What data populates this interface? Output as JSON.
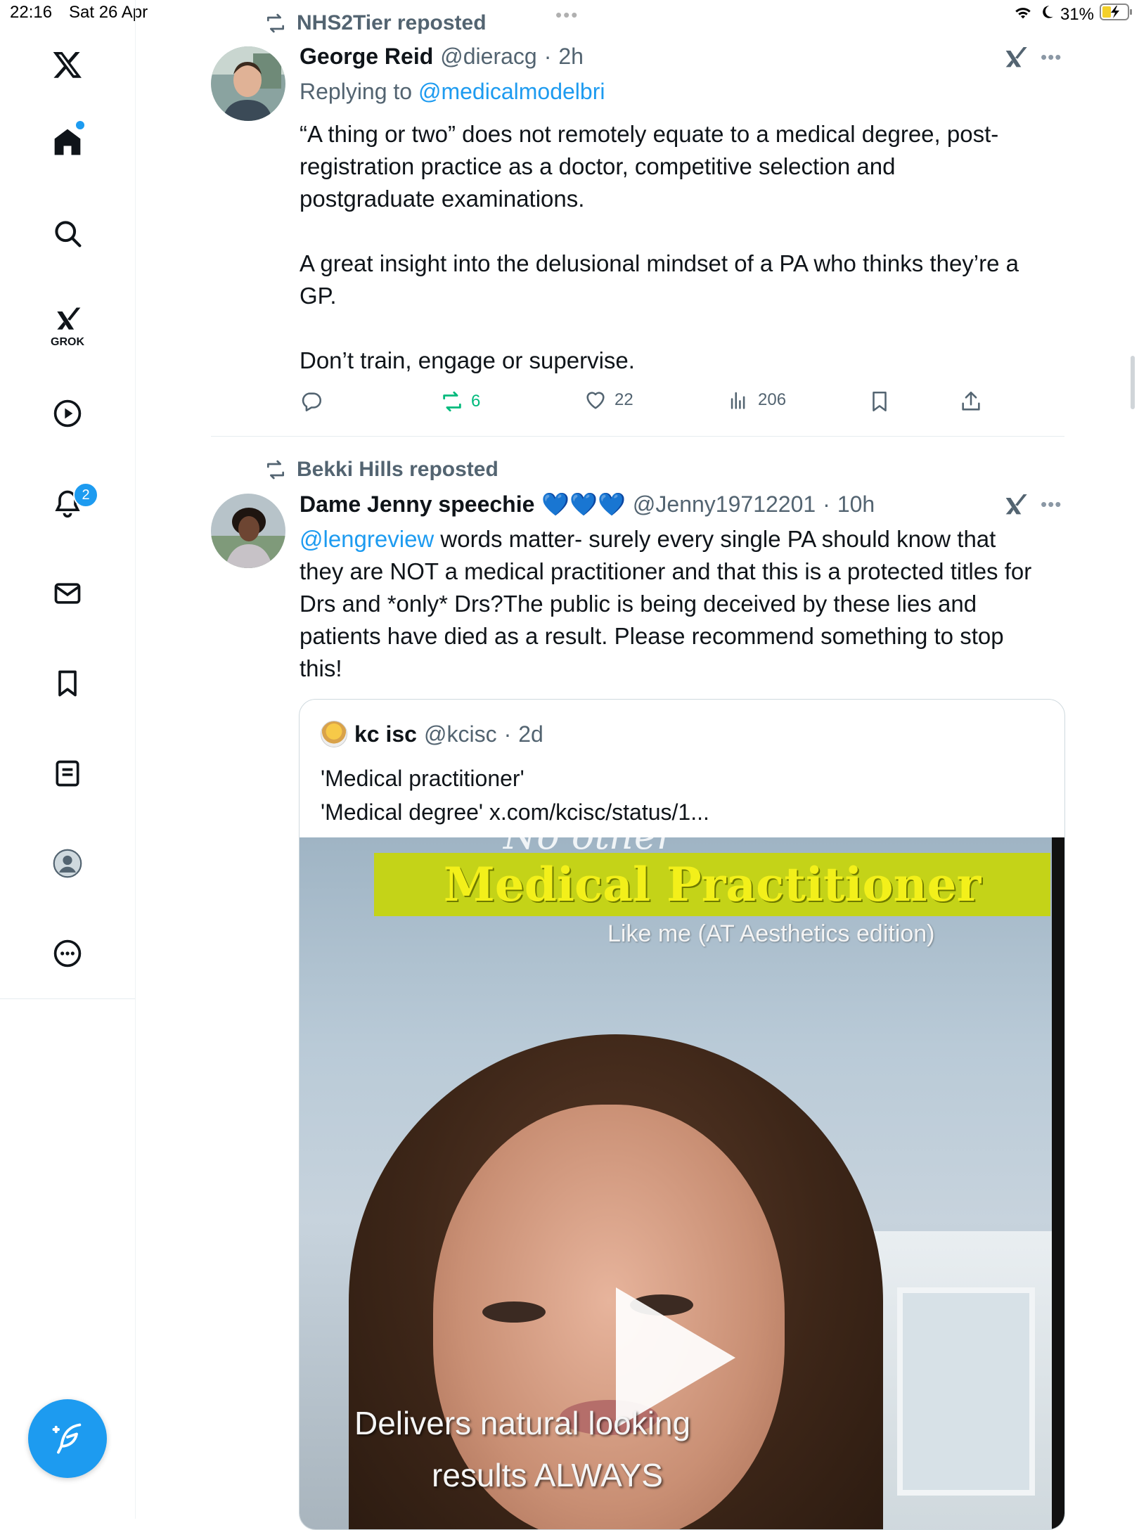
{
  "status_bar": {
    "time": "22:16",
    "date": "Sat 26 Apr",
    "battery": "31%",
    "icons": [
      "wifi-icon",
      "moon-icon",
      "battery-charging-icon"
    ]
  },
  "sidebar": {
    "items": [
      {
        "name": "x-logo-icon"
      },
      {
        "name": "home-icon",
        "has_dot": true
      },
      {
        "name": "search-icon"
      },
      {
        "name": "grok-icon",
        "label": "GROK"
      },
      {
        "name": "video-icon"
      },
      {
        "name": "notifications-icon",
        "badge": "2"
      },
      {
        "name": "messages-icon"
      },
      {
        "name": "bookmarks-icon"
      },
      {
        "name": "lists-icon"
      },
      {
        "name": "profile-icon"
      },
      {
        "name": "more-icon"
      }
    ],
    "compose_icon": "compose-icon"
  },
  "tweets": [
    {
      "repost_label": "NHS2Tier reposted",
      "name": "George Reid",
      "handle": "@dieracg",
      "time": "2h",
      "replying_prefix": "Replying to",
      "replying_to": "@medicalmodelbri",
      "body": "“A thing or two” does not remotely equate to a medical degree, post-\nregistration practice as a doctor, competitive selection and\npostgraduate examinations.\n\nA great insight into the delusional mindset of a PA who thinks they’re a\nGP.\n\nDon’t train, engage or supervise.",
      "actions": {
        "reposts": "6",
        "likes": "22",
        "views": "206"
      }
    },
    {
      "repost_label": "Bekki Hills reposted",
      "name": "Dame Jenny speechie",
      "name_emoji": "💙💙💙",
      "handle": "@Jenny19712201",
      "time": "10h",
      "mention": "@lengreview",
      "body_line1_rest": " words matter- surely every single PA should know that",
      "body_rest": "they are NOT a medical practitioner and that this is a protected titles for\nDrs and *only* Drs?The public is being deceived by these lies and\npatients have died as a result. Please recommend something to stop\nthis!",
      "quote": {
        "name": "kc isc",
        "handle": "@kcisc",
        "time": "2d",
        "body": "'Medical practitioner'\n'Medical degree' x.com/kcisc/status/1...",
        "media": {
          "overlay_top": "No other",
          "banner": "Medical Practitioner",
          "subtitle": "Like me (AT Aesthetics edition)",
          "caption_line1": "Delivers natural looking",
          "caption_line2": "results ALWAYS"
        }
      }
    }
  ],
  "colors": {
    "accent": "#1d9bf0",
    "repost_green": "#00ba7c",
    "muted": "#536471",
    "banner": "#c4d318"
  }
}
